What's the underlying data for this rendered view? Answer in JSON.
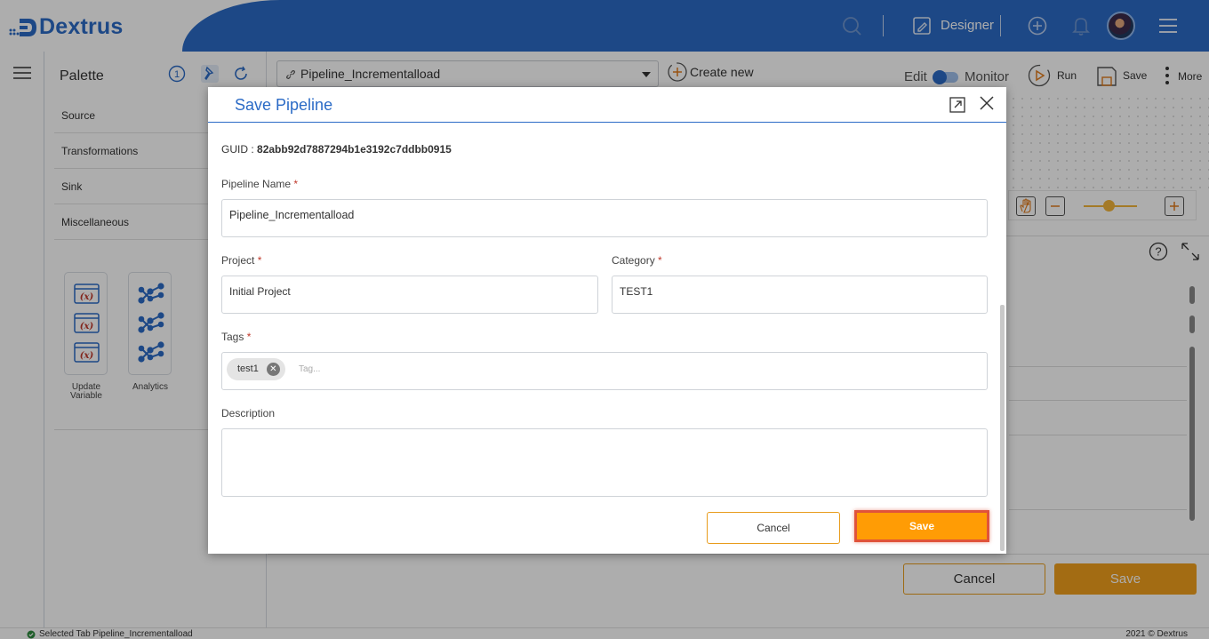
{
  "header": {
    "logo_text": "Dextrus",
    "designer_label": "Designer",
    "icons": [
      "search-icon",
      "designer-icon",
      "add-icon",
      "bell-icon",
      "avatar",
      "menu-icon"
    ]
  },
  "palette": {
    "title": "Palette",
    "sections": [
      "Source",
      "Transformations",
      "Sink",
      "Miscellaneous"
    ],
    "tiles": [
      {
        "label": "Update\nVariable",
        "icon": "variable-icon"
      },
      {
        "label": "Analytics",
        "icon": "analytics-icon"
      }
    ]
  },
  "toolbar": {
    "pipeline_selected": "Pipeline_Incrementalload",
    "create_new": "Create new",
    "edit_label": "Edit",
    "monitor_label": "Monitor",
    "run_label": "Run",
    "save_label": "Save",
    "more_label": "More"
  },
  "background_buttons": {
    "cancel": "Cancel",
    "save": "Save"
  },
  "status": {
    "left": "Selected Tab Pipeline_Incrementalload",
    "right": "2021 © Dextrus"
  },
  "modal": {
    "title": "Save Pipeline",
    "guid_label": "GUID : ",
    "guid_value": "82abb92d7887294b1e3192c7ddbb0915",
    "pipeline_name_label": "Pipeline Name",
    "pipeline_name_value": "Pipeline_Incrementalload",
    "project_label": "Project",
    "project_value": "Initial Project",
    "category_label": "Category",
    "category_value": "TEST1",
    "tags_label": "Tags",
    "tags": [
      "test1"
    ],
    "tag_placeholder": "Tag...",
    "description_label": "Description",
    "description_value": "",
    "required_mark": "*",
    "cancel_label": "Cancel",
    "save_label": "Save"
  },
  "colors": {
    "brand_blue": "#2b6bc6",
    "accent_orange": "#ff9c05",
    "highlight_red": "#e0533a"
  }
}
